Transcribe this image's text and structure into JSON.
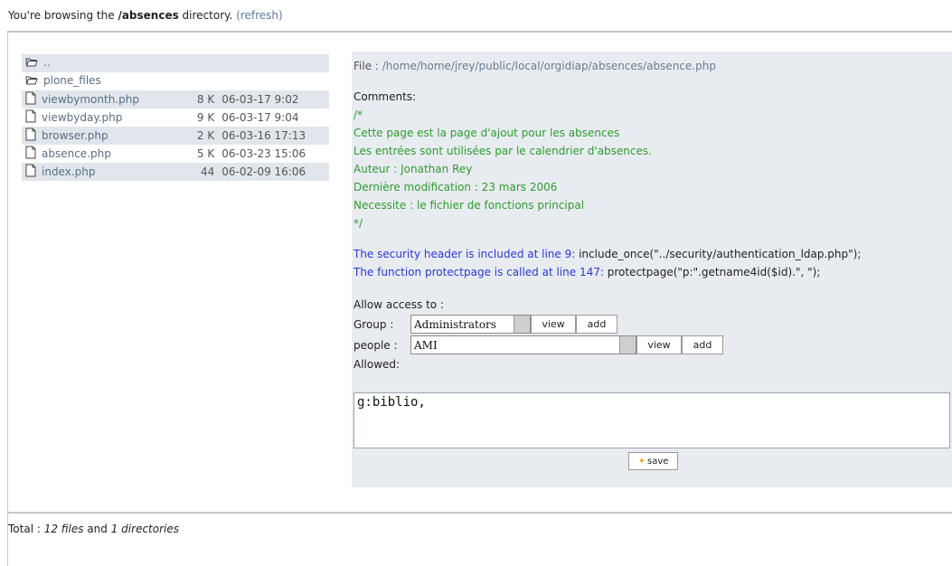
{
  "header": {
    "prefix": "You're browsing the ",
    "dir": "/absences",
    "suffix": " directory. ",
    "refresh_link": "(refresh)"
  },
  "files": [
    {
      "name": "..",
      "type": "folder",
      "size": "",
      "date": ""
    },
    {
      "name": "plone_files",
      "type": "folder",
      "size": "",
      "date": ""
    },
    {
      "name": "viewbymonth.php",
      "type": "file",
      "size": "8 K",
      "date": "06-03-17 9:02"
    },
    {
      "name": "viewbyday.php",
      "type": "file",
      "size": "9 K",
      "date": "06-03-17 9:04"
    },
    {
      "name": "browser.php",
      "type": "file",
      "size": "2 K",
      "date": "06-03-16 17:13"
    },
    {
      "name": "absence.php",
      "type": "file",
      "size": "5 K",
      "date": "06-03-23 15:06"
    },
    {
      "name": "index.php",
      "type": "file",
      "size": "44",
      "date": "06-02-09 16:06"
    }
  ],
  "detail": {
    "file_label": "File : ",
    "file_path": "/home/home/jrey/public/local/orgidiap/absences/absence.php",
    "comments_label": "Comments:",
    "comment_lines": [
      "/*",
      "Cette page est la page d'ajout pour les absences",
      "Les entrées sont utilisées par le calendrier d'absences.",
      "Auteur : Jonathan Rey",
      "Dernière modification : 23 mars 2006",
      "Necessite : le fichier de fonctions principal",
      "*/"
    ],
    "security_text": "The security header is included at line 9:",
    "security_code": " include_once(\"../security/authentication_ldap.php\");",
    "protect_text": "The function protectpage is called at line 147:",
    "protect_code": " protectpage(\"p:\".getname4id($id).\", \");",
    "allow_label": "Allow access to :",
    "group_label": "Group :",
    "group_value": "Administrators",
    "people_label": "people :",
    "people_value": "AMI",
    "view_label": "view",
    "add_label": "add",
    "allowed_label": "Allowed:",
    "allowed_value": "g:biblio,",
    "save_label": "save"
  },
  "footer": {
    "prefix": "Total : ",
    "files_count": "12 files",
    "middle": " and ",
    "dirs_count": "1 directories"
  },
  "icons": {
    "folder": "folder-open-icon",
    "file": "file-icon",
    "save": "star-icon"
  }
}
